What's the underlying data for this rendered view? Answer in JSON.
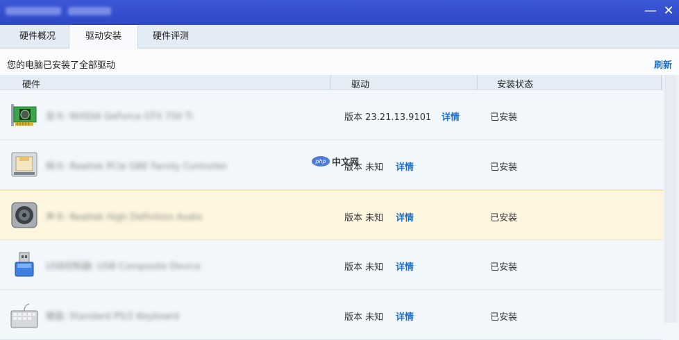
{
  "window": {
    "close_glyph": "✕",
    "minimize_glyph": "—"
  },
  "tabs": [
    {
      "label": "硬件概况",
      "active": false
    },
    {
      "label": "驱动安装",
      "active": true
    },
    {
      "label": "硬件评测",
      "active": false
    }
  ],
  "status": {
    "text": "您的电脑已安装了全部驱动",
    "refresh_label": "刷新"
  },
  "table": {
    "columns": [
      "硬件",
      "驱动",
      "安装状态"
    ],
    "rows": [
      {
        "icon": "graphics-card-icon",
        "name": "显卡: NVIDIA GeForce GTX 750 Ti",
        "version": "版本 23.21.13.9101",
        "detail": "详情",
        "state": "已安装"
      },
      {
        "icon": "network-adapter-icon",
        "name": "网卡: Realtek PCIe GBE Family Controller",
        "version": "版本 未知",
        "detail": "详情",
        "state": "已安装"
      },
      {
        "icon": "speaker-icon",
        "name": "声卡: Realtek High Definition Audio",
        "version": "版本 未知",
        "detail": "详情",
        "state": "已安装"
      },
      {
        "icon": "usb-icon",
        "name": "USB控制器: USB Composite Device",
        "version": "版本 未知",
        "detail": "详情",
        "state": "已安装"
      },
      {
        "icon": "keyboard-icon",
        "name": "键盘: Standard PS/2 Keyboard",
        "version": "版本 未知",
        "detail": "详情",
        "state": "已安装"
      }
    ]
  },
  "watermark": {
    "badge": "php",
    "text": "中文网"
  },
  "colors": {
    "title_bar": "#3a57d6",
    "link": "#1f72c8",
    "highlight_row": "#fef6df"
  }
}
